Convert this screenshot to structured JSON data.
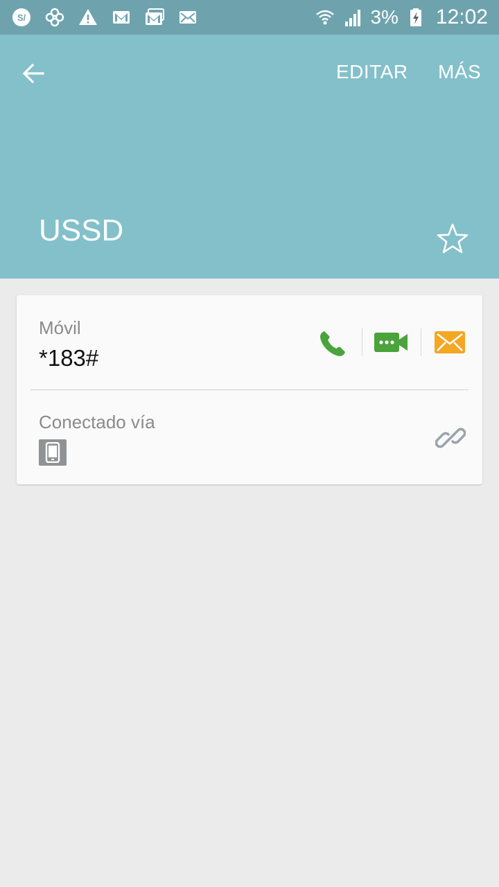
{
  "status_bar": {
    "battery_percent": "3%",
    "time": "12:02",
    "left_icons": [
      "s-app-icon",
      "pinwheel-icon",
      "warning-icon",
      "gmail-icon",
      "gmail-icon",
      "email-icon"
    ],
    "right_icons": [
      "wifi-icon",
      "signal-icon",
      "battery-charging-icon"
    ]
  },
  "header": {
    "edit_label": "EDITAR",
    "more_label": "MÁS",
    "contact_name": "USSD",
    "color": "#83c0ca"
  },
  "card": {
    "phone_label": "Móvil",
    "phone_number": "*183#",
    "connected_label": "Conectado vía",
    "colors": {
      "call": "#4aa33b",
      "video": "#4aa33b",
      "message": "#f5a623",
      "link": "#9aa4ab"
    }
  }
}
